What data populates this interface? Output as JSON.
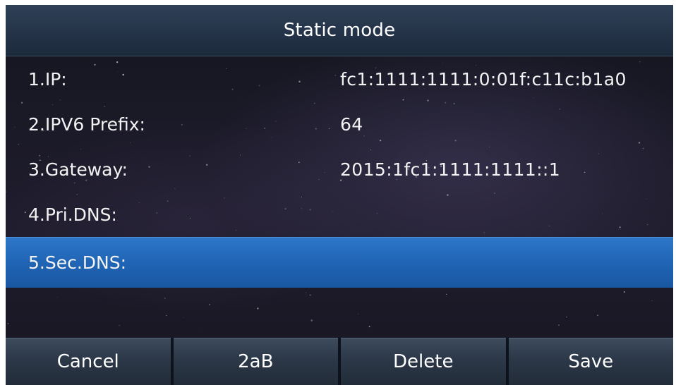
{
  "header": {
    "title": "Static mode"
  },
  "rows": [
    {
      "label": "1.IP:",
      "value": "fc1:1111:1111:0:01f:c11c:b1a0"
    },
    {
      "label": "2.IPV6 Prefix:",
      "value": "64"
    },
    {
      "label": "3.Gateway:",
      "value": "2015:1fc1:1111:1111::1"
    },
    {
      "label": "4.Pri.DNS:",
      "value": ""
    },
    {
      "label": "5.Sec.DNS:",
      "value": "",
      "selected": true
    }
  ],
  "softkeys": [
    {
      "label": "Cancel"
    },
    {
      "label": "2aB"
    },
    {
      "label": "Delete"
    },
    {
      "label": "Save"
    }
  ],
  "colors": {
    "header": "#2a3a50",
    "selected_row": "#2368b8",
    "softkey": "#2f3b4b",
    "text": "#ffffff"
  }
}
